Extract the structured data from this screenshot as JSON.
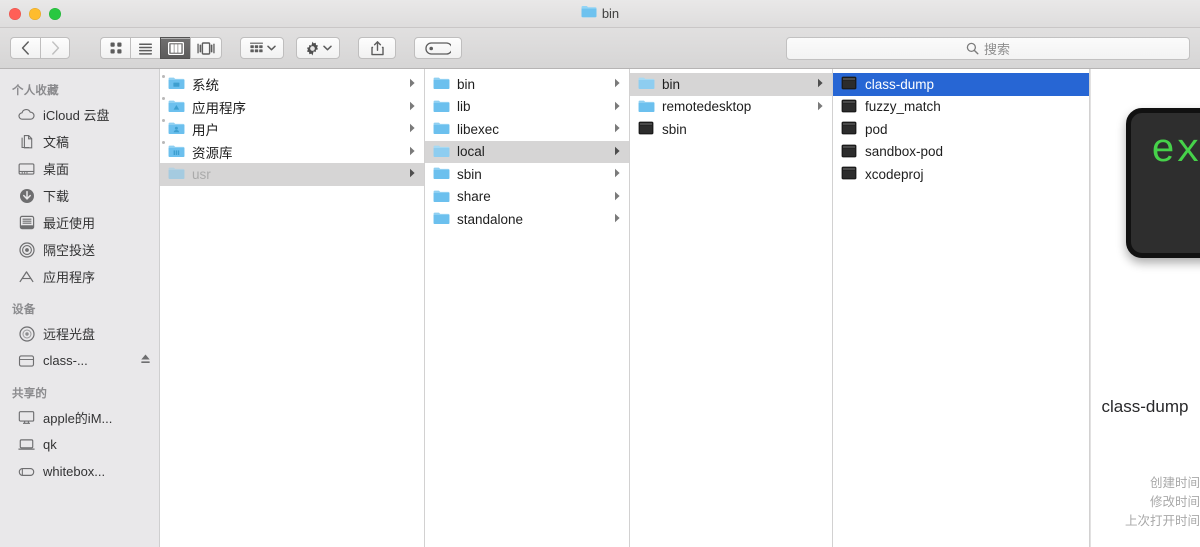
{
  "window": {
    "title": "bin",
    "title_icon": "folder-icon",
    "traffic_lights": [
      {
        "name": "close-button",
        "color": "#ff5f57"
      },
      {
        "name": "minimize-button",
        "color": "#febc2e"
      },
      {
        "name": "maximize-button",
        "color": "#28c840"
      }
    ]
  },
  "toolbar": {
    "back_label": "‹",
    "forward_label": "›",
    "view_buttons": [
      {
        "name": "view-as-icons-button",
        "icon": "grid-icon",
        "active": false
      },
      {
        "name": "view-as-list-button",
        "icon": "list-icon",
        "active": false
      },
      {
        "name": "view-as-columns-button",
        "icon": "columns-icon",
        "active": true
      },
      {
        "name": "view-as-gallery-button",
        "icon": "gallery-icon",
        "active": false
      }
    ],
    "arrange_button": "arrange-icon",
    "action_button": "gear-icon",
    "share_button": "share-icon",
    "tags_button": "tag-icon"
  },
  "search": {
    "placeholder": "搜索",
    "icon": "search-icon",
    "value": ""
  },
  "sidebar": {
    "sections": [
      {
        "header": "个人收藏",
        "items": [
          {
            "label": "iCloud 云盘",
            "icon": "cloud-icon"
          },
          {
            "label": "文稿",
            "icon": "documents-icon"
          },
          {
            "label": "桌面",
            "icon": "desktop-icon"
          },
          {
            "label": "下载",
            "icon": "downloads-icon"
          },
          {
            "label": "最近使用",
            "icon": "recents-icon"
          },
          {
            "label": "隔空投送",
            "icon": "airdrop-icon"
          },
          {
            "label": "应用程序",
            "icon": "applications-icon"
          }
        ]
      },
      {
        "header": "设备",
        "items": [
          {
            "label": "远程光盘",
            "icon": "remote-disc-icon"
          },
          {
            "label": "class-...",
            "icon": "external-drive-icon",
            "eject": true
          }
        ]
      },
      {
        "header": "共享的",
        "items": [
          {
            "label": "apple的iM...",
            "icon": "imac-icon"
          },
          {
            "label": "qk",
            "icon": "laptop-icon"
          },
          {
            "label": "whitebox...",
            "icon": "server-icon"
          }
        ]
      }
    ]
  },
  "columns": [
    {
      "name": "column-1",
      "items": [
        {
          "label": "系统",
          "type": "folder-system",
          "arrow": true,
          "state": "none"
        },
        {
          "label": "应用程序",
          "type": "folder-apps",
          "arrow": true,
          "state": "none"
        },
        {
          "label": "用户",
          "type": "folder-users",
          "arrow": true,
          "state": "none"
        },
        {
          "label": "资源库",
          "type": "folder-library",
          "arrow": true,
          "state": "none"
        },
        {
          "label": "usr",
          "type": "folder",
          "arrow": true,
          "state": "selected-dim"
        }
      ]
    },
    {
      "name": "column-2",
      "items": [
        {
          "label": "bin",
          "type": "folder",
          "arrow": true,
          "state": "none"
        },
        {
          "label": "lib",
          "type": "folder",
          "arrow": true,
          "state": "none"
        },
        {
          "label": "libexec",
          "type": "folder",
          "arrow": true,
          "state": "none"
        },
        {
          "label": "local",
          "type": "folder",
          "arrow": true,
          "state": "selected-gray"
        },
        {
          "label": "sbin",
          "type": "folder",
          "arrow": true,
          "state": "none"
        },
        {
          "label": "share",
          "type": "folder",
          "arrow": true,
          "state": "none"
        },
        {
          "label": "standalone",
          "type": "folder",
          "arrow": true,
          "state": "none"
        }
      ]
    },
    {
      "name": "column-3",
      "items": [
        {
          "label": "bin",
          "type": "folder",
          "arrow": true,
          "state": "selected-gray"
        },
        {
          "label": "remotedesktop",
          "type": "folder",
          "arrow": true,
          "state": "none"
        },
        {
          "label": "sbin",
          "type": "executable",
          "arrow": false,
          "state": "none"
        }
      ]
    },
    {
      "name": "column-4",
      "items": [
        {
          "label": "class-dump",
          "type": "executable",
          "arrow": false,
          "state": "selected-blue"
        },
        {
          "label": "fuzzy_match",
          "type": "executable",
          "arrow": false,
          "state": "none"
        },
        {
          "label": "pod",
          "type": "executable",
          "arrow": false,
          "state": "none"
        },
        {
          "label": "sandbox-pod",
          "type": "executable",
          "arrow": false,
          "state": "none"
        },
        {
          "label": "xcodeproj",
          "type": "executable",
          "arrow": false,
          "state": "none"
        }
      ]
    }
  ],
  "preview": {
    "icon_text": "exec",
    "icon_name": "executable-preview-icon",
    "file_name": "class-dump",
    "meta_labels": [
      "创建时间",
      "修改时间",
      "上次打开时间"
    ]
  },
  "colors": {
    "selection_blue": "#2766d4",
    "selection_gray": "#d6d5d5",
    "folder_blue": "#7ecbf2",
    "terminal_green": "#46d14a"
  }
}
